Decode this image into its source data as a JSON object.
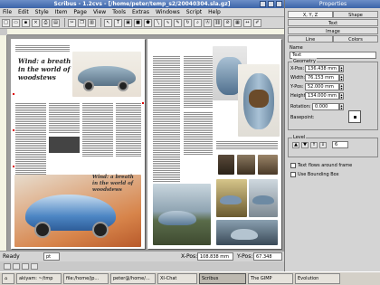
{
  "window": {
    "title": "Scribus - 1.2cvs - [/home/peter/temp_s2/20040304.sla.gz]"
  },
  "menu": [
    "File",
    "Edit",
    "Style",
    "Item",
    "Page",
    "View",
    "Tools",
    "Extras",
    "Windows",
    "Script",
    "Help"
  ],
  "toolbar": {
    "icons": [
      "new-doc",
      "open",
      "save",
      "close",
      "print",
      "pdf",
      "cut",
      "copy",
      "paste",
      "select",
      "text-frame",
      "image-frame",
      "shape",
      "polygon",
      "line",
      "bezier",
      "freehand",
      "rotate",
      "zoom",
      "edit-text",
      "link",
      "unlink",
      "table",
      "measure",
      "eyedropper"
    ]
  },
  "document": {
    "heading": "Wind: a breath in the world of woodstews",
    "heading_small": "Wind: a breath in the world of woodstews"
  },
  "status": {
    "ready": "Ready",
    "unit": "pt",
    "xpos_label": "X-Pos:",
    "xpos": "108.838 mm",
    "ypos_label": "Y-Pos:",
    "ypos": "67.348 mm"
  },
  "properties": {
    "title": "Properties",
    "tabs": [
      "X, Y, Z",
      "Shape",
      "Text",
      "Image",
      "Line",
      "Colors"
    ],
    "name_label": "Name",
    "name_value": "Text",
    "geometry_label": "Geometry",
    "x_label": "X-Pos:",
    "x_value": "136.438 mm",
    "y_label": "Y-Pos:",
    "y_value": "52.000 mm",
    "w_label": "Width:",
    "w_value": "76.153 mm",
    "h_label": "Height:",
    "h_value": "134.000 mm",
    "rot_label": "Rotation:",
    "rot_value": "0.000",
    "basepoint_label": "Basepoint:",
    "level_label": "Level",
    "level_value": "6",
    "flow_label": "Text flows around frame",
    "bbox_label": "Use Bounding Box"
  },
  "taskbar": {
    "items": [
      "akiyam: ~/tmp",
      "file:/home/jp...",
      "peter@/home/...",
      "XI-Chat",
      "Scribus",
      "The GIMP",
      "Evolution"
    ]
  }
}
